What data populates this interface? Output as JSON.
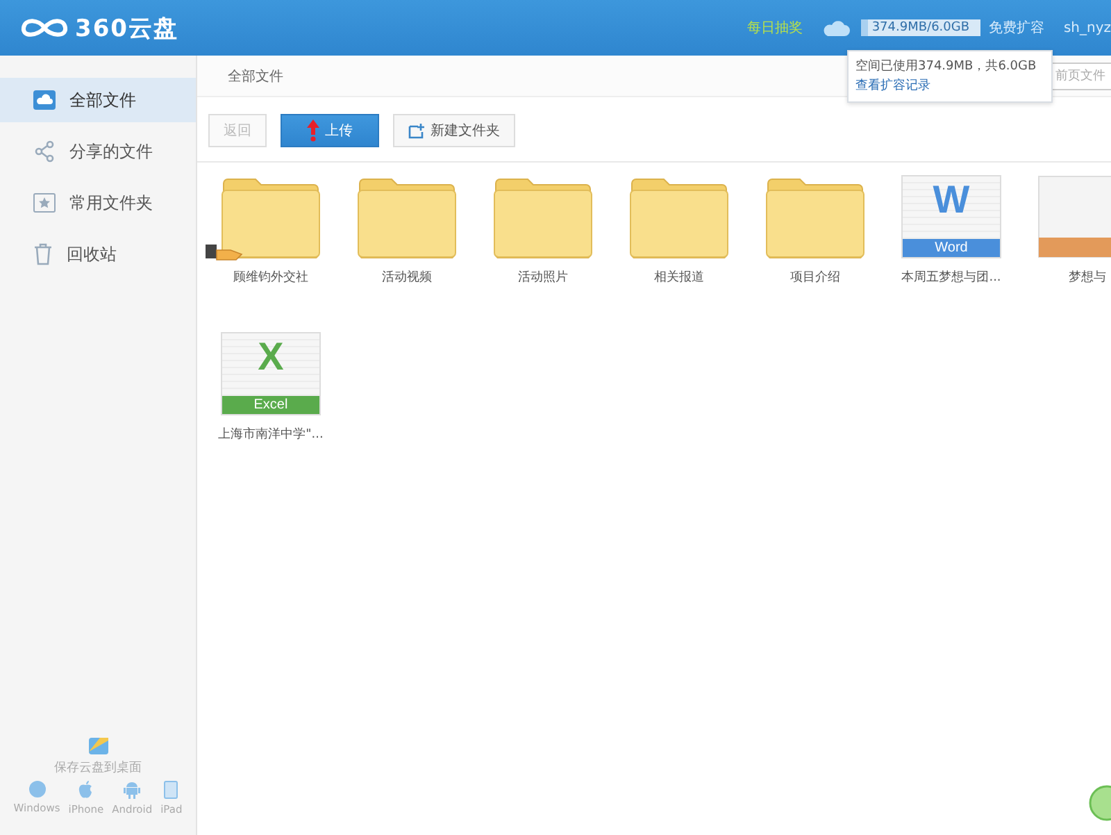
{
  "header": {
    "logo": "360云盘",
    "lottery": "每日抽奖",
    "storage": {
      "reading": "374.9MB/6.0GB",
      "level": 0.06
    },
    "expand": "免费扩容",
    "user": "sh_nyz"
  },
  "tooltip": {
    "text": "空间已使用374.9MB，共6.0GB",
    "link": "查看扩容记录"
  },
  "sidebar": {
    "items": [
      {
        "label": "全部文件",
        "selected": true
      },
      {
        "label": "分享的文件",
        "selected": false
      },
      {
        "label": "常用文件夹",
        "selected": false
      },
      {
        "label": "回收站",
        "selected": false
      }
    ],
    "desktop": "保存云盘到桌面",
    "platforms": [
      {
        "label": "Windows"
      },
      {
        "label": "iPhone"
      },
      {
        "label": "Android"
      },
      {
        "label": "iPad"
      }
    ]
  },
  "breadcrumb": "全部文件",
  "search": {
    "placeholder": "前页文件"
  },
  "toolbar": {
    "back": {
      "label": "返回",
      "disabled": true
    },
    "upload": "上传",
    "new_folder": "新建文件夹"
  },
  "files": [
    {
      "name": "顾维钧外交社",
      "kind": "folder",
      "shared": true
    },
    {
      "name": "活动视频",
      "kind": "folder",
      "shared": false
    },
    {
      "name": "活动照片",
      "kind": "folder",
      "shared": false
    },
    {
      "name": "相关报道",
      "kind": "folder",
      "shared": false
    },
    {
      "name": "项目介绍",
      "kind": "folder",
      "shared": false
    },
    {
      "name": "本周五梦想与团...",
      "kind": "word",
      "badge": "Word",
      "letter": "W"
    },
    {
      "name": "梦想与",
      "kind": "slides"
    },
    {
      "name": "上海市南洋中学\"...",
      "kind": "excel",
      "badge": "Excel",
      "letter": "X"
    }
  ]
}
